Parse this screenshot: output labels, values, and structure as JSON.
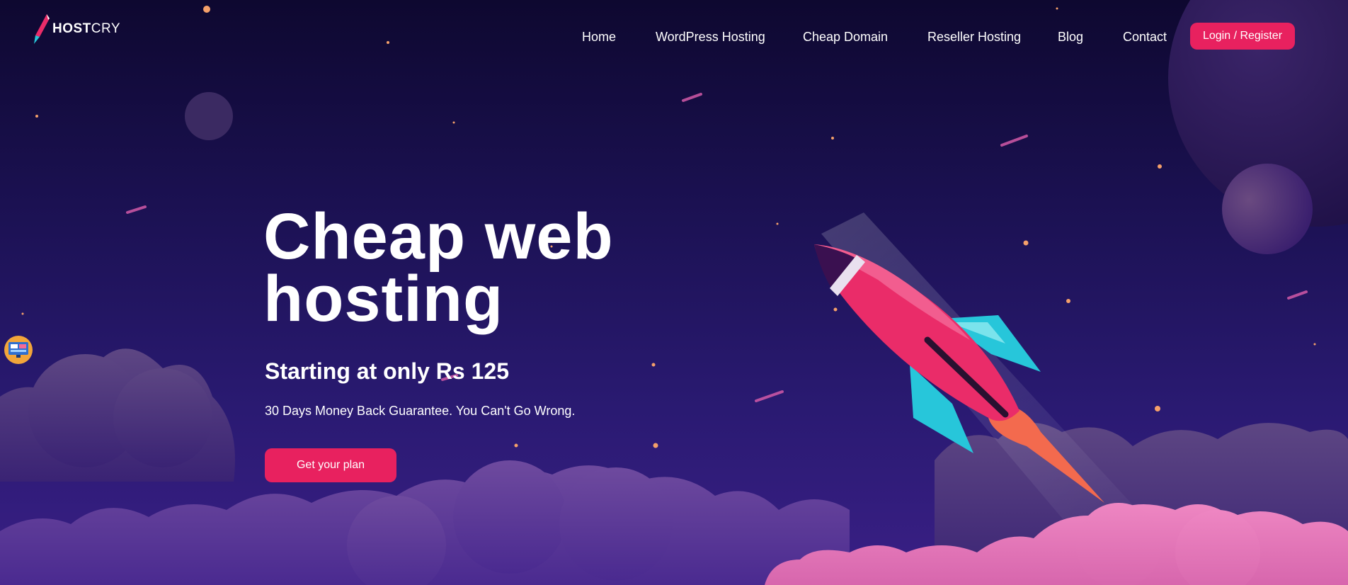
{
  "brand": {
    "name_bold": "HOST",
    "name_light": "CRY",
    "logo_icon": "rocket-logo-icon"
  },
  "nav": {
    "items": [
      {
        "label": "Home"
      },
      {
        "label": "WordPress Hosting"
      },
      {
        "label": "Cheap Domain"
      },
      {
        "label": "Reseller Hosting"
      },
      {
        "label": "Blog"
      },
      {
        "label": "Contact"
      }
    ],
    "login_label": "Login / Register"
  },
  "hero": {
    "title_line1": "Cheap web",
    "title_line2": "hosting",
    "subtitle": "Starting at only Rs 125",
    "note": "30 Days Money Back Guarantee. You Can't Go Wrong.",
    "cta_label": "Get your plan"
  },
  "side_widget": {
    "icon": "monitor-chat-icon"
  },
  "colors": {
    "accent": "#e8215f",
    "bg_top": "#0e0830",
    "bg_bottom": "#3a1f86",
    "rocket_body": "#ea2c69",
    "rocket_fin": "#27c6da"
  }
}
